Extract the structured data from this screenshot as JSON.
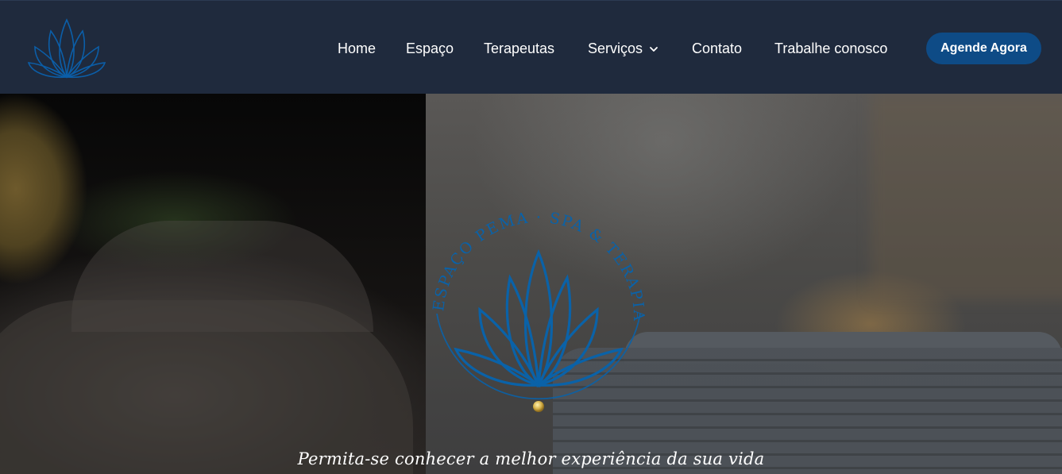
{
  "header": {
    "logo_icon": "lotus-logo-icon",
    "nav": {
      "home": "Home",
      "espaco": "Espaço",
      "terapeutas": "Terapeutas",
      "servicos": "Serviços",
      "contato": "Contato",
      "trabalhe": "Trabalhe conosco"
    },
    "cta_label": "Agende Agora"
  },
  "hero": {
    "emblem_text": "ESPAÇO PEMA · SPA & TERAPIA",
    "tagline": "Permita-se conhecer a melhor experiência da sua vida"
  },
  "colors": {
    "header_bg": "#1f2a3d",
    "accent_blue": "#0e4b86",
    "lotus_blue": "#0a62a8",
    "gold": "#d7b24a"
  }
}
